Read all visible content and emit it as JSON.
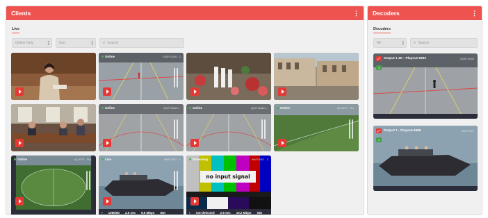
{
  "clients": {
    "title": "Clients",
    "tab": "Live",
    "filter_online": "Online Only",
    "filter_sort": "Sort",
    "search_placeholder": "Search",
    "tiles": [
      {
        "status": "",
        "code": "",
        "scene": "speaker"
      },
      {
        "status": "Online",
        "code": "IQSP-0045 - 1",
        "scene": "court"
      },
      {
        "status": "",
        "code": "",
        "scene": "flowers"
      },
      {
        "status": "",
        "code": "",
        "scene": "street"
      },
      {
        "status": "",
        "code": "",
        "scene": "conference"
      },
      {
        "status": "Online",
        "code": "IQSP-Baltim...",
        "scene": "court-meters"
      },
      {
        "status": "Online",
        "code": "IQSP-Baltim...",
        "scene": "court-meters"
      },
      {
        "status": "Online",
        "code": "IQ-0070 - Pla...",
        "scene": "field-meters"
      },
      {
        "status": "Online",
        "code": "IQ-0070 - Pla...",
        "scene": "field-round"
      },
      {
        "status": "Live",
        "code": "WMT0567 - 1",
        "scene": "boat",
        "info": {
          "format": "1080i50",
          "latency": "2.6 sec",
          "bitrate": "9.6 Mbps",
          "input": "SDI"
        }
      },
      {
        "status": "Streaming",
        "code": "WMT0567 - 2",
        "scene": "bars",
        "no_signal": "no input signal",
        "info": {
          "format": "not-detected",
          "latency": "2.6 sec",
          "bitrate": "10.2 Mbps",
          "input": "SDI"
        }
      }
    ]
  },
  "decoders": {
    "title": "Decoders",
    "tab": "Decoders",
    "filter_all": "All",
    "search_placeholder": "Search",
    "tiles": [
      {
        "title": "Output 1 4K - Playout-9492",
        "code": "IQSP-0049",
        "scene": "court"
      },
      {
        "title": "Output 1 - Playout-9596",
        "code": "WMT0067",
        "scene": "boat"
      }
    ]
  },
  "colors": {
    "accent": "#ef5350",
    "play": "#e53935",
    "online": "#4caf50"
  }
}
